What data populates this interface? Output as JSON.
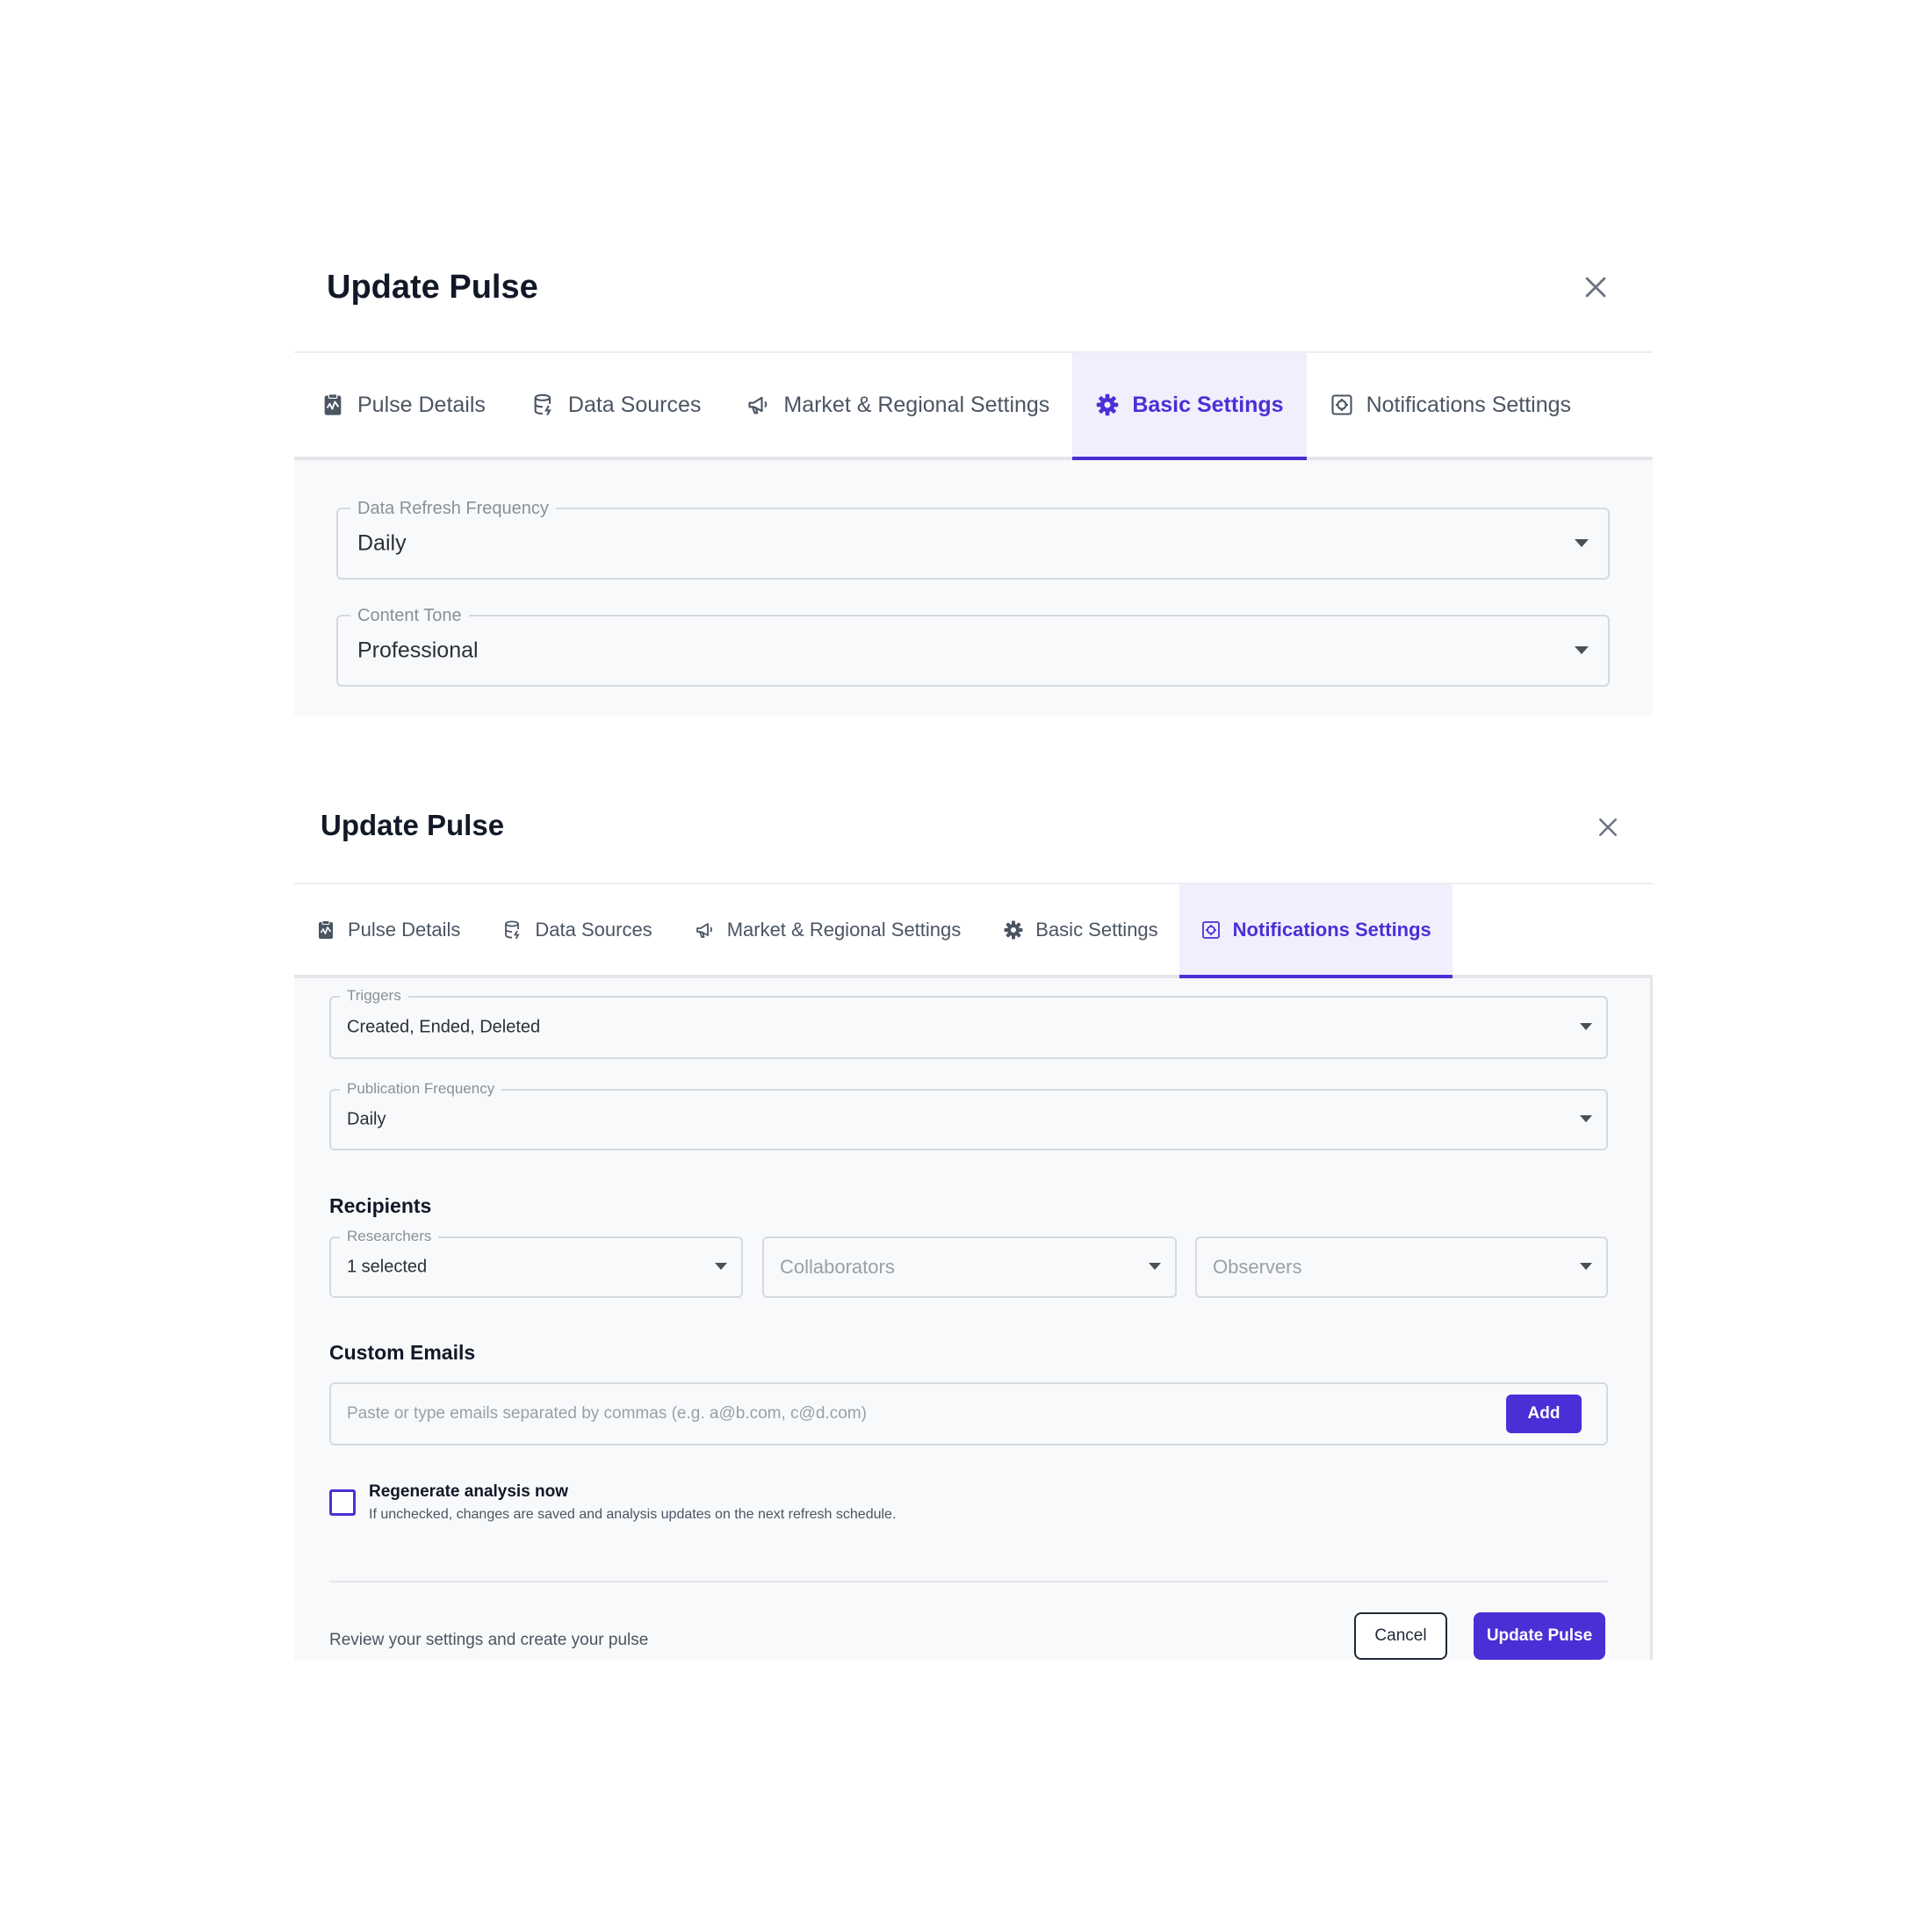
{
  "colors": {
    "accent": "#4b2fd6",
    "active_tab_bg": "#f1effd",
    "content_bg": "#f8f9fa"
  },
  "panel1": {
    "title": "Update Pulse",
    "tabs": [
      {
        "label": "Pulse Details",
        "icon": "clipboard-icon"
      },
      {
        "label": "Data Sources",
        "icon": "database-icon"
      },
      {
        "label": "Market & Regional Settings",
        "icon": "megaphone-icon"
      },
      {
        "label": "Basic Settings",
        "icon": "gear-icon",
        "active": true
      },
      {
        "label": "Notifications Settings",
        "icon": "notification-box-icon"
      }
    ],
    "refresh": {
      "label": "Data Refresh Frequency",
      "value": "Daily"
    },
    "tone": {
      "label": "Content Tone",
      "value": "Professional"
    }
  },
  "panel2": {
    "title": "Update Pulse",
    "tabs": [
      {
        "label": "Pulse Details",
        "icon": "clipboard-icon"
      },
      {
        "label": "Data Sources",
        "icon": "database-icon"
      },
      {
        "label": "Market & Regional Settings",
        "icon": "megaphone-icon"
      },
      {
        "label": "Basic Settings",
        "icon": "gear-icon"
      },
      {
        "label": "Notifications Settings",
        "icon": "notification-box-icon",
        "active": true
      }
    ],
    "triggers": {
      "label": "Triggers",
      "value": "Created, Ended, Deleted"
    },
    "publication": {
      "label": "Publication Frequency",
      "value": "Daily"
    },
    "recipients": {
      "title": "Recipients",
      "researchers": {
        "label": "Researchers",
        "value": "1 selected"
      },
      "collaborators": {
        "placeholder": "Collaborators"
      },
      "observers": {
        "placeholder": "Observers"
      }
    },
    "custom_emails": {
      "title": "Custom Emails",
      "placeholder": "Paste or type emails separated by commas (e.g. a@b.com, c@d.com)",
      "add_label": "Add"
    },
    "regenerate": {
      "label": "Regenerate analysis now",
      "help": "If unchecked, changes are saved and analysis updates on the next refresh schedule.",
      "checked": false
    },
    "footer": {
      "text": "Review your settings and create your pulse",
      "cancel_label": "Cancel",
      "update_label": "Update Pulse"
    }
  }
}
